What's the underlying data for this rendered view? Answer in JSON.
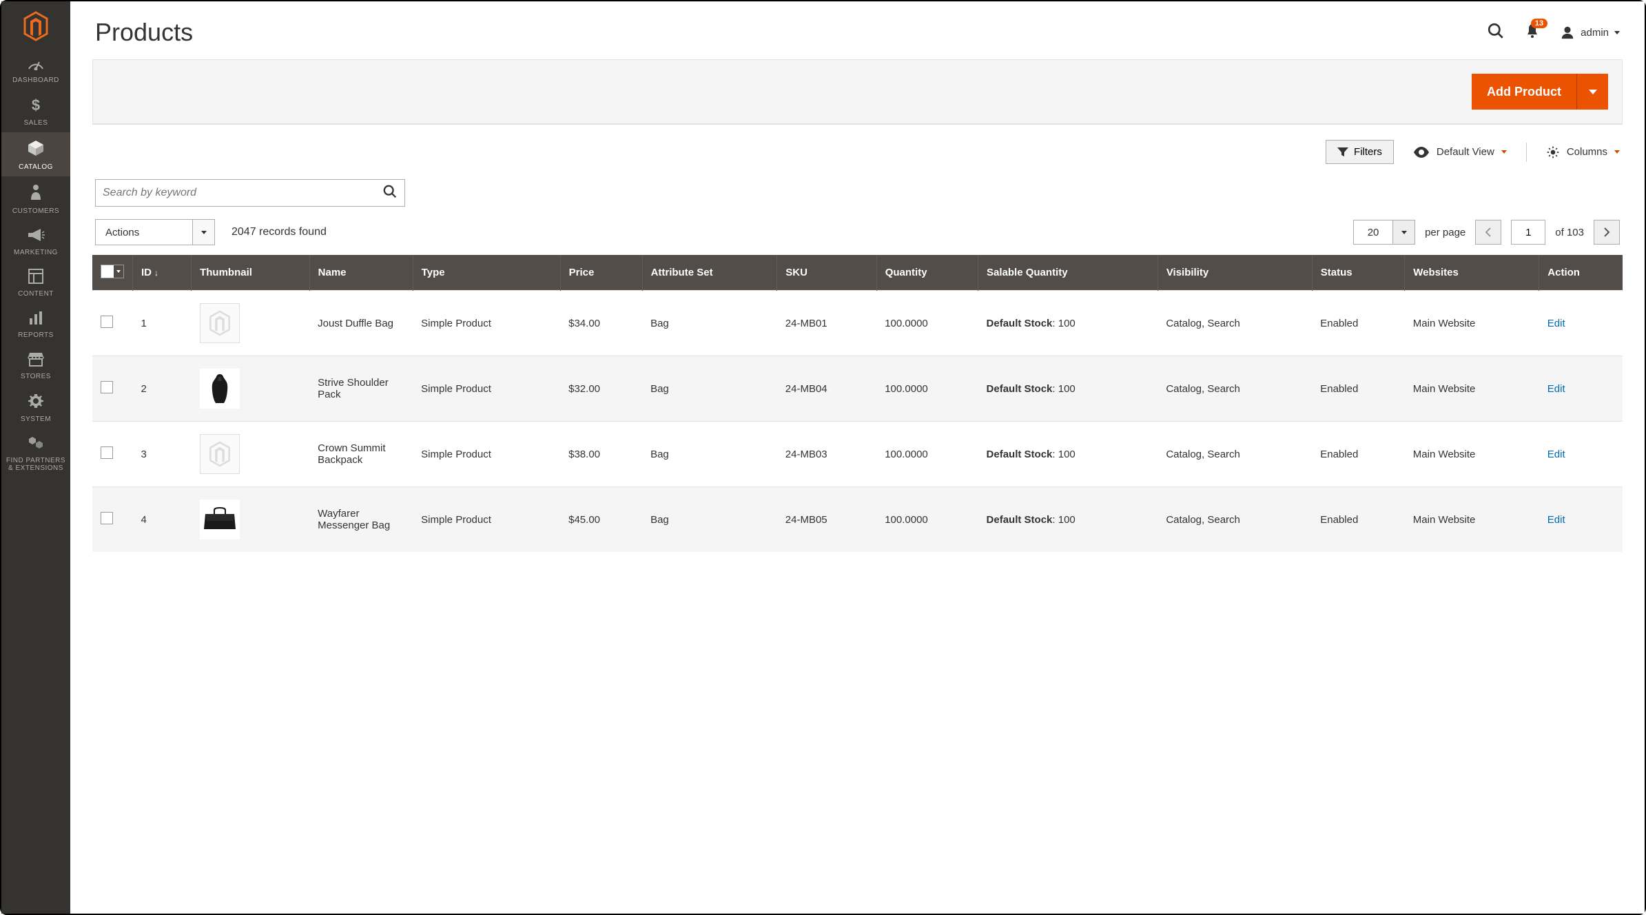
{
  "sidebar": {
    "items": [
      {
        "label": "DASHBOARD",
        "icon": "gauge"
      },
      {
        "label": "SALES",
        "icon": "dollar"
      },
      {
        "label": "CATALOG",
        "icon": "cube",
        "active": true
      },
      {
        "label": "CUSTOMERS",
        "icon": "person"
      },
      {
        "label": "MARKETING",
        "icon": "megaphone"
      },
      {
        "label": "CONTENT",
        "icon": "layout"
      },
      {
        "label": "REPORTS",
        "icon": "bars"
      },
      {
        "label": "STORES",
        "icon": "storefront"
      },
      {
        "label": "SYSTEM",
        "icon": "gear"
      },
      {
        "label": "FIND PARTNERS & EXTENSIONS",
        "icon": "blocks"
      }
    ]
  },
  "header": {
    "page_title": "Products",
    "notification_count": "13",
    "admin_user_label": "admin"
  },
  "toolbar": {
    "add_product_label": "Add Product"
  },
  "controls": {
    "filters_label": "Filters",
    "default_view_label": "Default View",
    "columns_label": "Columns"
  },
  "search": {
    "placeholder": "Search by keyword"
  },
  "actions": {
    "actions_label": "Actions",
    "records_found": "2047 records found"
  },
  "pager": {
    "page_size": "20",
    "per_page_label": "per page",
    "current_page": "1",
    "of_label": "of 103"
  },
  "grid": {
    "columns": {
      "id": "ID",
      "thumbnail": "Thumbnail",
      "name": "Name",
      "type": "Type",
      "price": "Price",
      "attribute_set": "Attribute Set",
      "sku": "SKU",
      "quantity": "Quantity",
      "salable_quantity": "Salable Quantity",
      "visibility": "Visibility",
      "status": "Status",
      "websites": "Websites",
      "action": "Action"
    },
    "action_label": "Edit",
    "rows": [
      {
        "id": "1",
        "thumbnail": "placeholder",
        "name": "Joust Duffle Bag",
        "type": "Simple Product",
        "price": "$34.00",
        "attribute_set": "Bag",
        "sku": "24-MB01",
        "quantity": "100.0000",
        "salable_quantity_label": "Default Stock",
        "salable_quantity_value": ": 100",
        "visibility": "Catalog, Search",
        "status": "Enabled",
        "websites": "Main Website"
      },
      {
        "id": "2",
        "thumbnail": "backpack-dark",
        "name": "Strive Shoulder Pack",
        "type": "Simple Product",
        "price": "$32.00",
        "attribute_set": "Bag",
        "sku": "24-MB04",
        "quantity": "100.0000",
        "salable_quantity_label": "Default Stock",
        "salable_quantity_value": ": 100",
        "visibility": "Catalog, Search",
        "status": "Enabled",
        "websites": "Main Website"
      },
      {
        "id": "3",
        "thumbnail": "placeholder",
        "name": "Crown Summit Backpack",
        "type": "Simple Product",
        "price": "$38.00",
        "attribute_set": "Bag",
        "sku": "24-MB03",
        "quantity": "100.0000",
        "salable_quantity_label": "Default Stock",
        "salable_quantity_value": ": 100",
        "visibility": "Catalog, Search",
        "status": "Enabled",
        "websites": "Main Website"
      },
      {
        "id": "4",
        "thumbnail": "messenger-dark",
        "name": "Wayfarer Messenger Bag",
        "type": "Simple Product",
        "price": "$45.00",
        "attribute_set": "Bag",
        "sku": "24-MB05",
        "quantity": "100.0000",
        "salable_quantity_label": "Default Stock",
        "salable_quantity_value": ": 100",
        "visibility": "Catalog, Search",
        "status": "Enabled",
        "websites": "Main Website"
      }
    ]
  }
}
